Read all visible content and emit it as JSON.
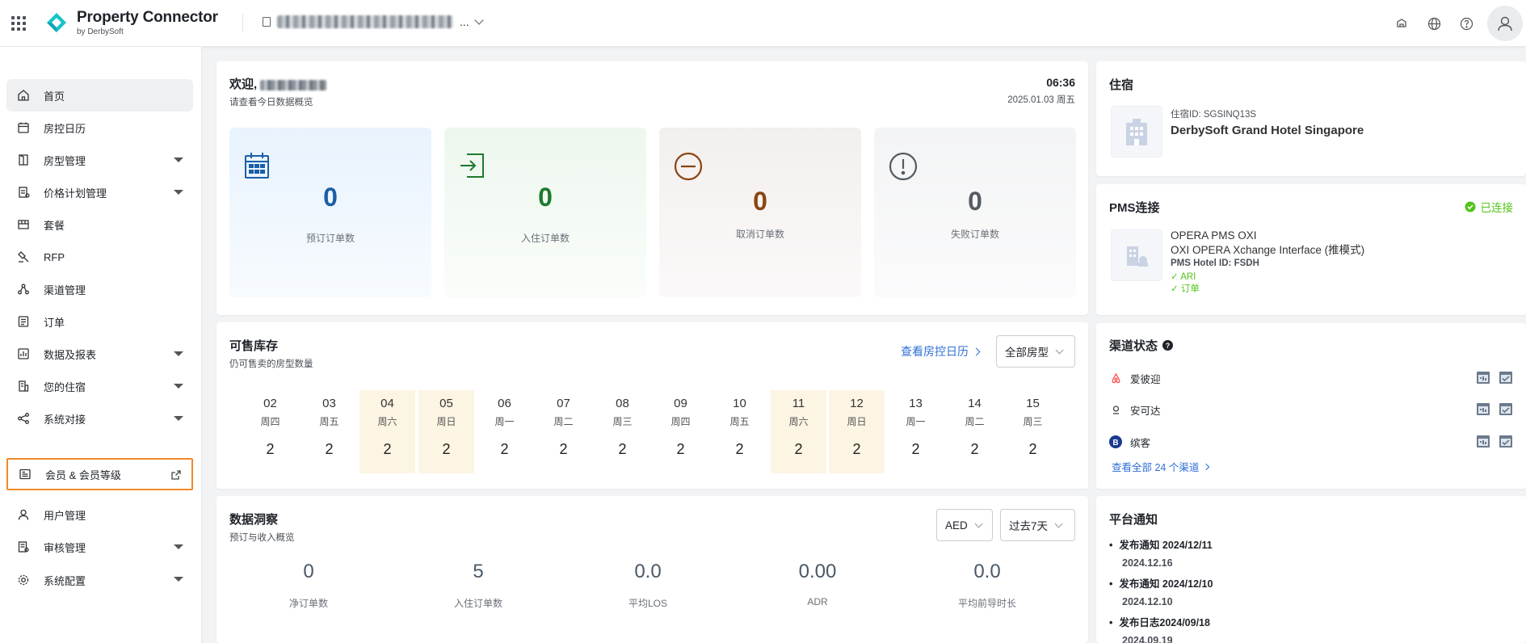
{
  "app": {
    "title": "Property Connector",
    "subtitle": "by DerbySoft",
    "header_icons": [
      "notification-icon",
      "globe-icon",
      "help-icon",
      "user-icon"
    ]
  },
  "sidebar": {
    "items": [
      {
        "label": "首页",
        "icon": "home-icon",
        "active": true
      },
      {
        "label": "房控日历",
        "icon": "calendar-icon"
      },
      {
        "label": "房型管理",
        "icon": "room-icon",
        "expandable": true
      },
      {
        "label": "价格计划管理",
        "icon": "price-icon",
        "expandable": true
      },
      {
        "label": "套餐",
        "icon": "package-icon"
      },
      {
        "label": "RFP",
        "icon": "gavel-icon"
      },
      {
        "label": "渠道管理",
        "icon": "channel-icon"
      },
      {
        "label": "订单",
        "icon": "order-icon"
      },
      {
        "label": "数据及报表",
        "icon": "report-icon",
        "expandable": true
      },
      {
        "label": "您的住宿",
        "icon": "building-icon",
        "expandable": true
      },
      {
        "label": "系统对接",
        "icon": "share-icon",
        "expandable": true
      },
      {
        "label": "会员 & 会员等级",
        "icon": "member-icon",
        "external": true,
        "highlighted": true
      },
      {
        "label": "用户管理",
        "icon": "user-icon"
      },
      {
        "label": "审核管理",
        "icon": "audit-icon",
        "expandable": true
      },
      {
        "label": "系统配置",
        "icon": "settings-icon",
        "expandable": true
      }
    ]
  },
  "welcome": {
    "greeting": "欢迎,",
    "subtitle": "请查看今日数据概览",
    "time": "06:36",
    "date": "2025.01.03 周五",
    "stats": [
      {
        "value": "0",
        "label": "预订订单数",
        "color": "#1a5ea8"
      },
      {
        "value": "0",
        "label": "入住订单数",
        "color": "#1d7a2e"
      },
      {
        "value": "0",
        "label": "取消订单数",
        "color": "#8a4512"
      },
      {
        "value": "0",
        "label": "失败订单数",
        "color": "#555b63"
      }
    ]
  },
  "inventory": {
    "title": "可售库存",
    "subtitle": "仍可售卖的房型数量",
    "link": "查看房控日历",
    "room_type": "全部房型",
    "days": [
      {
        "date": "02",
        "weekday": "周四",
        "value": "2"
      },
      {
        "date": "03",
        "weekday": "周五",
        "value": "2"
      },
      {
        "date": "04",
        "weekday": "周六",
        "value": "2",
        "weekend": true
      },
      {
        "date": "05",
        "weekday": "周日",
        "value": "2",
        "weekend": true
      },
      {
        "date": "06",
        "weekday": "周一",
        "value": "2"
      },
      {
        "date": "07",
        "weekday": "周二",
        "value": "2"
      },
      {
        "date": "08",
        "weekday": "周三",
        "value": "2"
      },
      {
        "date": "09",
        "weekday": "周四",
        "value": "2"
      },
      {
        "date": "10",
        "weekday": "周五",
        "value": "2"
      },
      {
        "date": "11",
        "weekday": "周六",
        "value": "2",
        "weekend": true
      },
      {
        "date": "12",
        "weekday": "周日",
        "value": "2",
        "weekend": true
      },
      {
        "date": "13",
        "weekday": "周一",
        "value": "2"
      },
      {
        "date": "14",
        "weekday": "周二",
        "value": "2"
      },
      {
        "date": "15",
        "weekday": "周三",
        "value": "2"
      }
    ]
  },
  "insights": {
    "title": "数据洞察",
    "subtitle": "预订与收入概览",
    "currency": "AED",
    "range": "过去7天",
    "metrics": [
      {
        "value": "0",
        "label": "净订单数"
      },
      {
        "value": "5",
        "label": "入住订单数"
      },
      {
        "value": "0.0",
        "label": "平均LOS"
      },
      {
        "value": "0.00",
        "label": "ADR"
      },
      {
        "value": "0.0",
        "label": "平均前导时长"
      }
    ]
  },
  "lodging": {
    "title": "住宿",
    "hotel_id": "住宿ID: SGSINQ13S",
    "hotel_name": "DerbySoft Grand Hotel Singapore"
  },
  "pms": {
    "title": "PMS连接",
    "status": "已连接",
    "name": "OPERA PMS OXI",
    "interface": "OXI OPERA Xchange Interface (推模式)",
    "hotel_id": "PMS Hotel ID: FSDH",
    "features": [
      "ARI",
      "订单"
    ],
    "status_color": "#52c41a"
  },
  "channels": {
    "title": "渠道状态",
    "items": [
      {
        "name": "爱彼迎",
        "icon": "airbnb-icon"
      },
      {
        "name": "安可达",
        "icon": "agoda-icon"
      },
      {
        "name": "缤客",
        "icon": "booking-icon"
      }
    ],
    "view_all": "查看全部 24 个渠道"
  },
  "notices": {
    "title": "平台通知",
    "items": [
      {
        "title": "发布通知 2024/12/11",
        "date": "2024.12.16"
      },
      {
        "title": "发布通知 2024/12/10",
        "date": "2024.12.10"
      },
      {
        "title": "发布日志2024/09/18",
        "date": "2024.09.19"
      }
    ]
  }
}
